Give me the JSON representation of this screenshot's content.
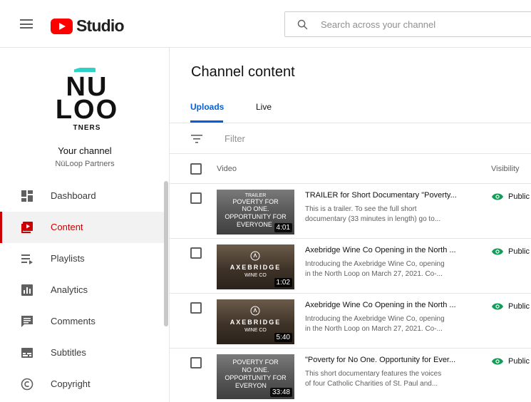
{
  "app": {
    "logo_text": "Studio"
  },
  "search": {
    "placeholder": "Search across your channel"
  },
  "channel": {
    "avatar_line1": "NU",
    "avatar_line2": "LOO",
    "avatar_line3": "TNERS",
    "label": "Your channel",
    "name": "NüLoop Partners"
  },
  "sidebar": {
    "items": [
      {
        "label": "Dashboard",
        "icon": "dashboard-icon"
      },
      {
        "label": "Content",
        "icon": "content-icon",
        "active": true
      },
      {
        "label": "Playlists",
        "icon": "playlists-icon"
      },
      {
        "label": "Analytics",
        "icon": "analytics-icon"
      },
      {
        "label": "Comments",
        "icon": "comments-icon"
      },
      {
        "label": "Subtitles",
        "icon": "subtitles-icon"
      },
      {
        "label": "Copyright",
        "icon": "copyright-icon"
      }
    ]
  },
  "main": {
    "title": "Channel content",
    "tabs": [
      {
        "label": "Uploads",
        "active": true
      },
      {
        "label": "Live"
      }
    ],
    "filter_placeholder": "Filter",
    "columns": {
      "video": "Video",
      "visibility": "Visibility"
    },
    "videos": [
      {
        "thumb_lines": [
          "TRAILER",
          "POVERTY FOR",
          "NO ONE.",
          "OPPORTUNITY FOR",
          "EVERYONE"
        ],
        "duration": "4:01",
        "title": "TRAILER for Short Documentary \"Poverty...",
        "desc1": "This is a trailer. To see the full short",
        "desc2": "documentary (33 minutes in length) go to...",
        "visibility": "Public"
      },
      {
        "thumb_lines": [
          "AXEBRIDGE",
          "WINE CO"
        ],
        "duration": "1:02",
        "title": "Axebridge Wine Co Opening in the North ...",
        "desc1": "Introducing the Axebridge Wine Co, opening",
        "desc2": "in the North Loop on March 27, 2021. Co-...",
        "visibility": "Public"
      },
      {
        "thumb_lines": [
          "AXEBRIDGE",
          "WINE CO"
        ],
        "duration": "5:40",
        "title": "Axebridge Wine Co Opening in the North ...",
        "desc1": "Introducing the Axebridge Wine Co, opening",
        "desc2": "in the North Loop on March 27, 2021. Co-...",
        "visibility": "Public"
      },
      {
        "thumb_lines": [
          "POVERTY FOR",
          "NO ONE.",
          "OPPORTUNITY FOR",
          "EVERYON"
        ],
        "duration": "33:48",
        "title": "\"Poverty for No One. Opportunity for Ever...",
        "desc1": "This short documentary features the voices",
        "desc2": "of four Catholic Charities of St. Paul and...",
        "visibility": "Public"
      }
    ]
  },
  "colors": {
    "brand_red": "#ff0000",
    "active_red": "#cc0000",
    "link_blue": "#065fd4",
    "public_green": "#0f9d58"
  }
}
